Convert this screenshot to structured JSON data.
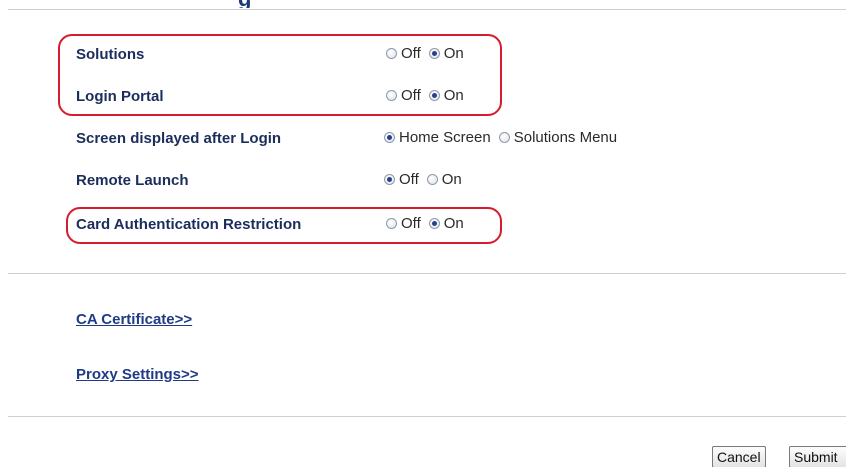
{
  "header": {
    "title_fragment": "g"
  },
  "settings": [
    {
      "label": "Solutions",
      "options": [
        {
          "label": "Off",
          "checked": false
        },
        {
          "label": "On",
          "checked": true
        }
      ]
    },
    {
      "label": "Login Portal",
      "options": [
        {
          "label": "Off",
          "checked": false
        },
        {
          "label": "On",
          "checked": true
        }
      ]
    },
    {
      "label": "Screen displayed after Login",
      "options": [
        {
          "label": "Home Screen",
          "checked": true
        },
        {
          "label": "Solutions Menu",
          "checked": false
        }
      ]
    },
    {
      "label": "Remote Launch",
      "options": [
        {
          "label": "Off",
          "checked": true
        },
        {
          "label": "On",
          "checked": false
        }
      ]
    },
    {
      "label": "Card Authentication Restriction",
      "options": [
        {
          "label": "Off",
          "checked": false
        },
        {
          "label": "On",
          "checked": true
        }
      ]
    }
  ],
  "links": {
    "ca_certificate": "CA Certificate>>",
    "proxy_settings": "Proxy Settings>>"
  },
  "buttons": {
    "cancel": "Cancel",
    "submit": "Submit"
  },
  "colors": {
    "highlight": "#d61b2a",
    "label_text": "#1b2d5c",
    "link_text": "#1f3b86"
  }
}
